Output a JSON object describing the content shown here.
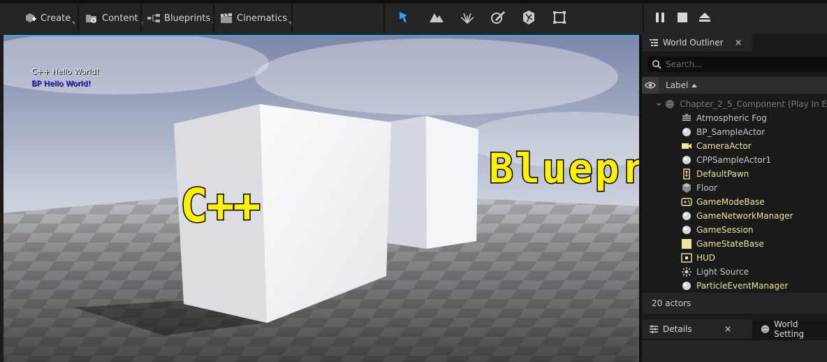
{
  "toolbar": {
    "create_label": "Create",
    "content_label": "Content",
    "blueprints_label": "Blueprints",
    "cinematics_label": "Cinematics"
  },
  "viewport": {
    "debug_lines": [
      "C++ Hello World!",
      "BP Hello World!"
    ],
    "debug_colors": [
      "#ffffff",
      "#3b38ff"
    ],
    "label_cpp": "C++",
    "label_blueprint": "Blueprint"
  },
  "outliner": {
    "tab_title": "World Outliner",
    "close_glyph": "×",
    "search_placeholder": "Search...",
    "column_label": "Label",
    "root": "Chapter_2_5_Component (Play In E",
    "items": [
      {
        "label": "Atmospheric Fog",
        "icon": "fog-icon",
        "color": "#c8c8c8"
      },
      {
        "label": "BP_SampleActor",
        "icon": "sphere-icon",
        "color": "#c8c8c8"
      },
      {
        "label": "CameraActor",
        "icon": "camera-icon",
        "color": "#f0e2a0"
      },
      {
        "label": "CPPSampleActor1",
        "icon": "sphere-icon",
        "color": "#c8c8c8"
      },
      {
        "label": "DefaultPawn",
        "icon": "pawn-icon",
        "color": "#f0e2a0"
      },
      {
        "label": "Floor",
        "icon": "cube-icon",
        "color": "#c8c8c8"
      },
      {
        "label": "GameModeBase",
        "icon": "gamepad-icon",
        "color": "#f0e2a0"
      },
      {
        "label": "GameNetworkManager",
        "icon": "sphere-icon",
        "color": "#f0e2a0"
      },
      {
        "label": "GameSession",
        "icon": "sphere-icon",
        "color": "#f0e2a0"
      },
      {
        "label": "GameStateBase",
        "icon": "square-icon",
        "color": "#f0e2a0"
      },
      {
        "label": "HUD",
        "icon": "hud-icon",
        "color": "#f0e2a0"
      },
      {
        "label": "Light Source",
        "icon": "sun-icon",
        "color": "#c8c8c8"
      },
      {
        "label": "ParticleEventManager",
        "icon": "sphere-icon",
        "color": "#f0e2a0"
      }
    ],
    "status": "20 actors"
  },
  "details": {
    "tab_details": "Details",
    "tab_world_settings": "World Setting",
    "close_glyph": "×"
  }
}
